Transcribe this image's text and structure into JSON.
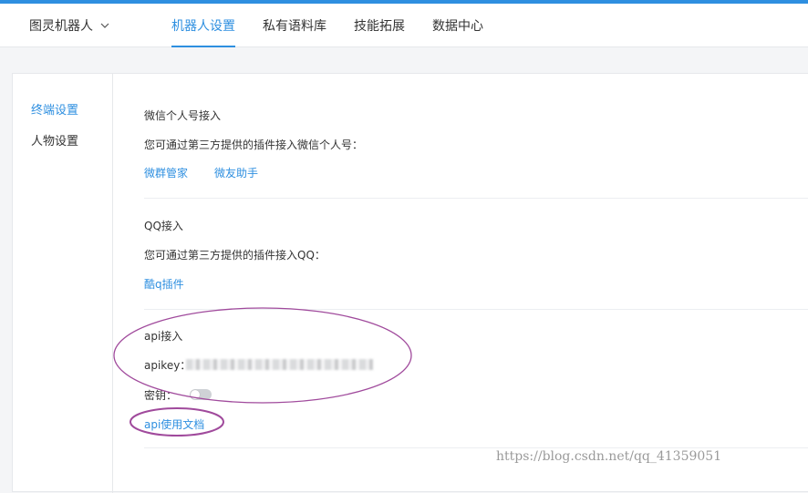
{
  "header": {
    "brand": "图灵机器人",
    "tabs": [
      {
        "label": "机器人设置",
        "active": true
      },
      {
        "label": "私有语料库"
      },
      {
        "label": "技能拓展"
      },
      {
        "label": "数据中心"
      }
    ]
  },
  "sidebar": {
    "items": [
      {
        "label": "终端设置",
        "active": true
      },
      {
        "label": "人物设置"
      }
    ]
  },
  "sections": {
    "wechat": {
      "title": "微信个人号接入",
      "desc": "您可通过第三方提供的插件接入微信个人号：",
      "links": [
        "微群管家",
        "微友助手"
      ]
    },
    "qq": {
      "title": "QQ接入",
      "desc": "您可通过第三方提供的插件接入QQ：",
      "links": [
        "酷q插件"
      ]
    },
    "api": {
      "title": "api接入",
      "apikey_label": "apikey：",
      "secret_label": "密钥：",
      "secret_enabled": false,
      "doc_link": "api使用文档"
    }
  },
  "watermark": "https://blog.csdn.net/qq_41359051",
  "colors": {
    "accent": "#2e8fe0",
    "annotation": "#a04a9c"
  },
  "icons": {
    "brand_dropdown": "chevron-down-icon"
  }
}
